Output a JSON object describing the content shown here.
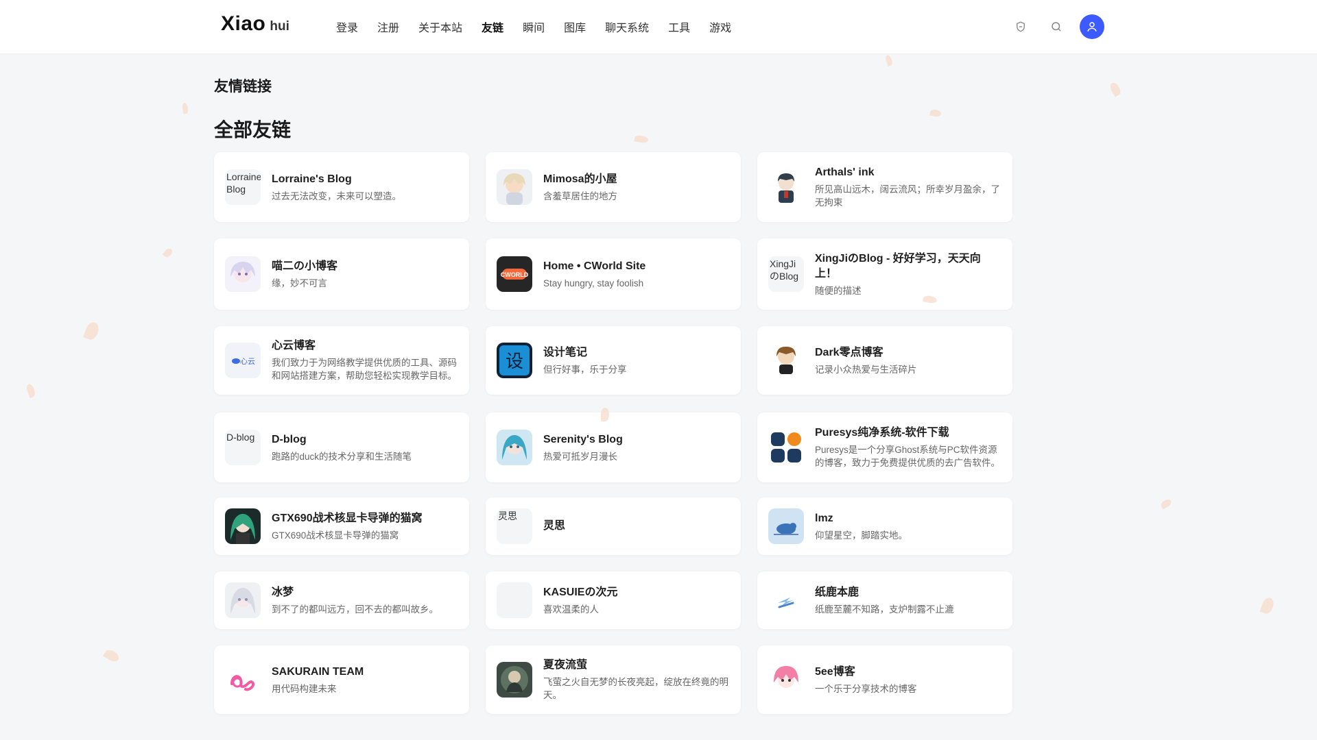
{
  "header": {
    "logo_main": "Xiao",
    "logo_sub": "hui",
    "nav": [
      "登录",
      "注册",
      "关于本站",
      "友链",
      "瞬间",
      "图库",
      "聊天系统",
      "工具",
      "游戏"
    ],
    "active_nav": "友链"
  },
  "page": {
    "crumb_title": "友情链接",
    "section_title": "全部友链"
  },
  "links": [
    {
      "name": "Lorraine's Blog",
      "desc": "过去无法改变，未来可以塑造。",
      "thumb_alt": "Lorraine's Blog",
      "thumb_style": "broken"
    },
    {
      "name": "Mimosa的小屋",
      "desc": "含羞草居住的地方",
      "thumb_style": "anime-light"
    },
    {
      "name": "Arthals' ink",
      "desc": "所见高山远木，阔云流风；所幸岁月盈余，了无拘束",
      "thumb_style": "boy-dark"
    },
    {
      "name": "喵二の小博客",
      "desc": "缘，妙不可言",
      "thumb_style": "anime-lavender"
    },
    {
      "name": "Home • CWorld Site",
      "desc": "Stay hungry, stay foolish",
      "thumb_style": "cworld"
    },
    {
      "name": "XingJiのBlog - 好好学习，天天向上！",
      "desc": "随便的描述",
      "thumb_alt": "XingJiのBlog",
      "thumb_style": "broken"
    },
    {
      "name": "心云博客",
      "desc": "我们致力于为网络教学提供优质的工具、源码和网站搭建方案，帮助您轻松实现教学目标。",
      "thumb_text": "心云",
      "thumb_style": "xinyun"
    },
    {
      "name": "设计笔记",
      "desc": "但行好事，乐于分享",
      "thumb_text": "设",
      "thumb_style": "design"
    },
    {
      "name": "Dark零点博客",
      "desc": "记录小众热爱与生活碎片",
      "thumb_style": "chibi"
    },
    {
      "name": "D-blog",
      "desc": "跑路的duck的技术分享和生活随笔",
      "thumb_alt": "D-blog",
      "thumb_style": "broken"
    },
    {
      "name": "Serenity's Blog",
      "desc": "热爱可抵岁月漫长",
      "thumb_style": "miku"
    },
    {
      "name": "Puresys纯净系统-软件下载",
      "desc": "Puresys是一个分享Ghost系统与PC软件资源的博客，致力于免费提供优质的去广告软件。",
      "thumb_style": "puresys"
    },
    {
      "name": "GTX690战术核显卡导弹的猫窝",
      "desc": "GTX690战术核显卡导弹的猫窝",
      "thumb_style": "green-anime"
    },
    {
      "name": "灵思",
      "desc": "",
      "thumb_alt": "灵思",
      "thumb_style": "broken"
    },
    {
      "name": "lmz",
      "desc": "仰望星空，脚踏实地。",
      "thumb_style": "bird"
    },
    {
      "name": "冰梦",
      "desc": "到不了的都叫远方，回不去的都叫故乡。",
      "thumb_style": "anime-silver"
    },
    {
      "name": "KASUIEの次元",
      "desc": "喜欢温柔的人",
      "thumb_style": "blank"
    },
    {
      "name": "纸鹿本鹿",
      "desc": "纸鹿至麓不知路，支炉制露不止漉",
      "thumb_style": "paper"
    },
    {
      "name": "SAKURAIN TEAM",
      "desc": "用代码构建未来",
      "thumb_style": "sakurain"
    },
    {
      "name": "夏夜流萤",
      "desc": "飞萤之火自无梦的长夜亮起，绽放在终竟的明天。",
      "thumb_style": "night"
    },
    {
      "name": "5ee博客",
      "desc": "一个乐于分享技术的博客",
      "thumb_style": "pink-hair"
    }
  ],
  "icons": {
    "theme": "shield-icon",
    "search": "search-icon",
    "user": "user-icon"
  },
  "colors": {
    "accent": "#3d5afe",
    "page_bg": "#f5f6f8"
  }
}
